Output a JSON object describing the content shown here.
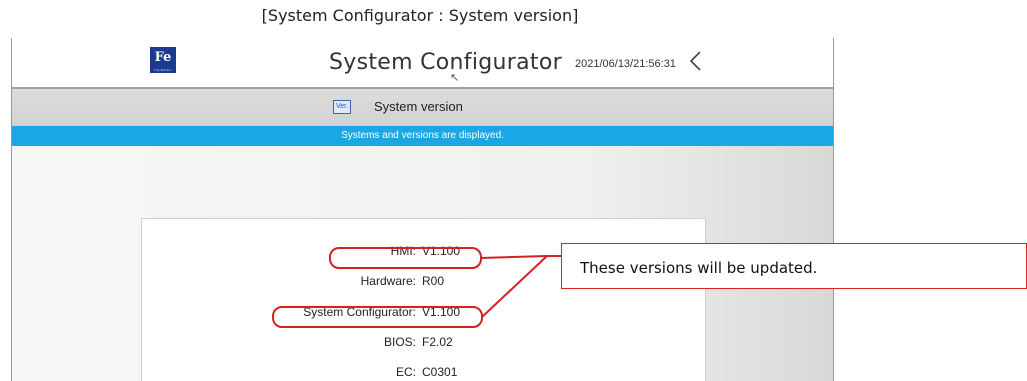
{
  "caption": "[System Configurator : System version]",
  "header": {
    "logo_text": "Fe",
    "logo_subtext": "Fuji Electric",
    "title": "System Configurator",
    "datetime": "2021/06/13/21:56:31",
    "back_icon": "chevron-left-icon"
  },
  "subbar": {
    "icon_text": "Ver.",
    "title": "System version"
  },
  "infobar": {
    "message": "Systems and versions are displayed."
  },
  "versions": [
    {
      "label": "HMI:",
      "value": "V1.100"
    },
    {
      "label": "Hardware:",
      "value": "R00"
    },
    {
      "label": "System Configurator:",
      "value": "V1.100"
    },
    {
      "label": "BIOS:",
      "value": "F2.02"
    },
    {
      "label": "EC:",
      "value": "C0301"
    }
  ],
  "callout": {
    "text": "These versions will be updated."
  },
  "colors": {
    "accent_blue": "#1ba6e6",
    "highlight_red": "#d22222",
    "logo_blue": "#1b3b8f"
  }
}
